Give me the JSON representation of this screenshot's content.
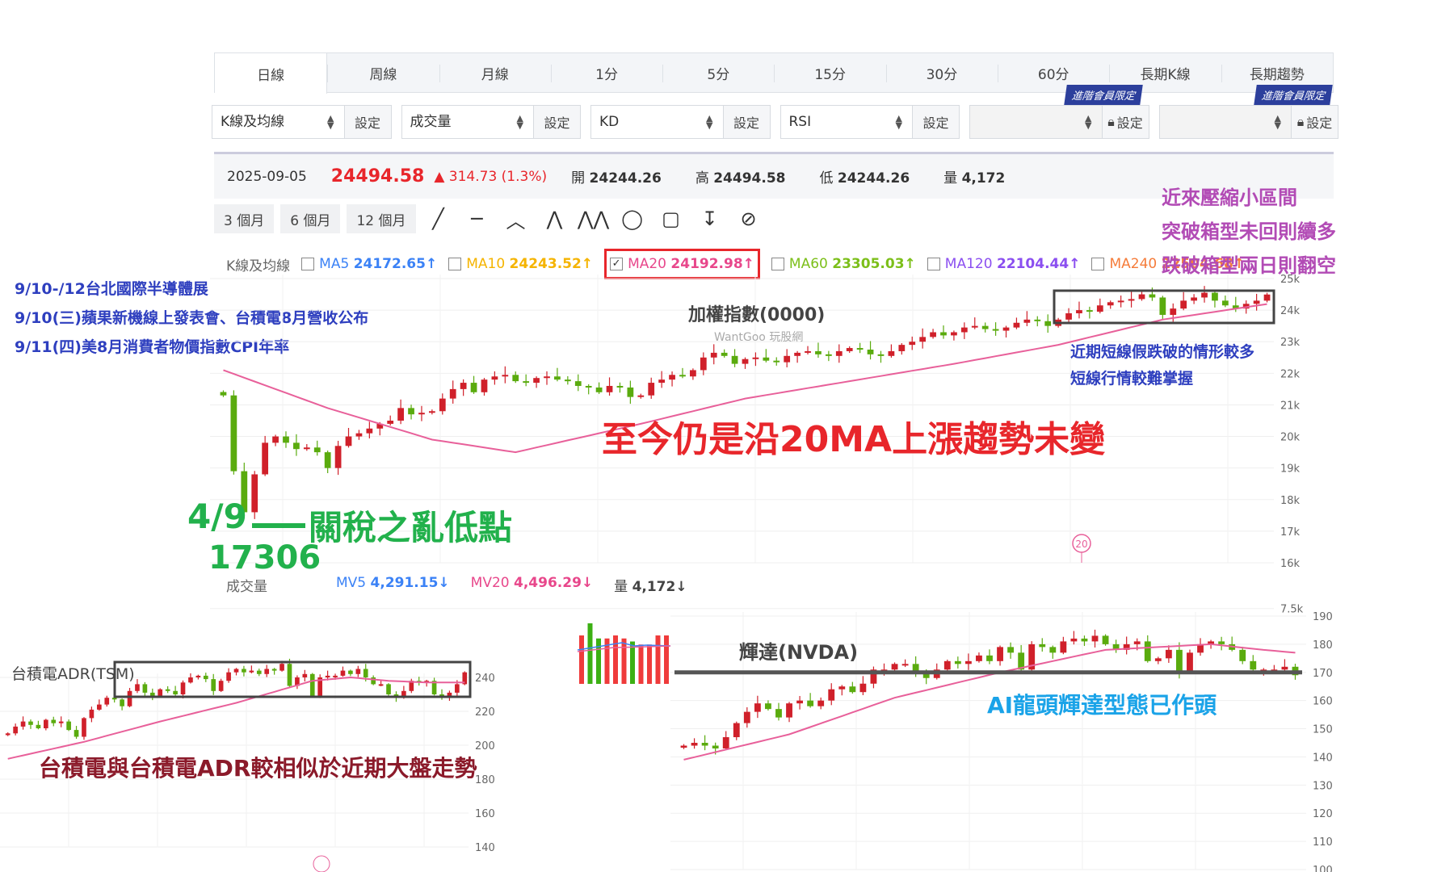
{
  "tabs": [
    "日線",
    "周線",
    "月線",
    "1分",
    "5分",
    "15分",
    "30分",
    "60分",
    "長期K線",
    "長期趨勢"
  ],
  "selectors": [
    {
      "value": "K線及均線",
      "button": "設定"
    },
    {
      "value": "成交量",
      "button": "設定"
    },
    {
      "value": "KD",
      "button": "設定"
    },
    {
      "value": "RSI",
      "button": "設定"
    },
    {
      "value": "",
      "button": "設定",
      "badge": "進階會員限定"
    },
    {
      "value": "",
      "button": "設定",
      "badge": "進階會員限定"
    }
  ],
  "info": {
    "date": "2025-09-05",
    "price": "24494.58",
    "change": "▲ 314.73 (1.3%)",
    "open_label": "開",
    "open": "24244.26",
    "high_label": "高",
    "high": "24494.58",
    "low_label": "低",
    "low": "24244.26",
    "vol_label": "量",
    "vol": "4,172"
  },
  "periods": [
    "3 個月",
    "6 個月",
    "12 個月"
  ],
  "tool_icons": [
    "line-tool",
    "horizontal-line-tool",
    "angle-tool",
    "abcd-pattern-tool",
    "xabcd-pattern-tool",
    "circle-tool",
    "rectangle-tool",
    "text-tool",
    "hide-drawings-tool"
  ],
  "ma_legend": {
    "label": "K線及均線",
    "items": [
      {
        "name": "MA5",
        "value": "24172.65↑",
        "color": "#3b82f6",
        "checked": false
      },
      {
        "name": "MA10",
        "value": "24243.52↑",
        "color": "#f5b400",
        "checked": false
      },
      {
        "name": "MA20",
        "value": "24192.98↑",
        "color": "#e8478b",
        "checked": true
      },
      {
        "name": "MA60",
        "value": "23305.03↑",
        "color": "#7cbf1a",
        "checked": false
      },
      {
        "name": "MA120",
        "value": "22104.44↑",
        "color": "#8b4ff0",
        "checked": false
      },
      {
        "name": "MA240",
        "value": "22504.68↑",
        "color": "#f57c3a",
        "checked": false
      }
    ]
  },
  "events": [
    "9/10-/12台北國際半導體展",
    "9/10(三)蘋果新機線上發表會、台積電8月營收公布",
    "9/11(四)美8月消費者物價指數CPI年率"
  ],
  "annotations": {
    "box_note": [
      "近來壓縮小區間",
      "突破箱型未回則續多",
      "跌破箱型兩日則翻空"
    ],
    "short_note": [
      "近期短線假跌破的情形較多",
      "短線行情較難掌握"
    ],
    "trend": "至今仍是沿20MA上漲趨勢未變",
    "low_date": "4/9",
    "low_text": "關稅之亂低點",
    "low_value": "17306",
    "tsm_note": "台積電與台積電ADR較相似於近期大盤走勢",
    "nvda_note": "AI龍頭輝達型態已作頭"
  },
  "main_chart": {
    "title": "加權指數(0000)",
    "watermark": "WantGoo 玩股網",
    "marker": "20"
  },
  "volume_legend": {
    "label": "成交量",
    "mv5": "MV5",
    "mv5_value": "4,291.15↓",
    "mv20": "MV20",
    "mv20_value": "4,496.29↓",
    "vol": "量",
    "vol_value": "4,172↓"
  },
  "colors": {
    "up": "#d0202a",
    "down": "#5aab0e",
    "ma20": "#e8609a"
  },
  "chart_data": [
    {
      "type": "candlestick",
      "title": "加權指數(0000)",
      "yticks": [
        "25k",
        "24k",
        "23k",
        "22k",
        "21k",
        "20k",
        "19k",
        "18k",
        "17k",
        "16k",
        "7.5k"
      ],
      "ylim": [
        16000,
        25000
      ],
      "close": [
        21300,
        18900,
        17600,
        18800,
        19800,
        20000,
        19800,
        19600,
        19650,
        19500,
        19000,
        19700,
        20000,
        20100,
        20250,
        20400,
        20500,
        20900,
        20700,
        20750,
        20800,
        21200,
        21500,
        21700,
        21400,
        21800,
        21900,
        21950,
        21750,
        21700,
        21850,
        21900,
        21800,
        21750,
        21600,
        21550,
        21400,
        21600,
        21550,
        21250,
        21300,
        21700,
        21800,
        21950,
        21900,
        22100,
        22500,
        22650,
        22550,
        22300,
        22450,
        22500,
        22400,
        22350,
        22550,
        22650,
        22700,
        22600,
        22550,
        22700,
        22800,
        22750,
        22600,
        22550,
        22700,
        22900,
        23000,
        23150,
        23300,
        23200,
        23300,
        23450,
        23500,
        23400,
        23350,
        23450,
        23600,
        23700,
        23650,
        23500,
        23700,
        23900,
        24000,
        23950,
        24150,
        24250,
        24300,
        24350,
        24500,
        24400,
        23850,
        24050,
        24300,
        24400,
        24550,
        24300,
        24150,
        24050,
        24200,
        24300,
        24494.58
      ],
      "ma20_knots": [
        [
          0,
          22100
        ],
        [
          10,
          20900
        ],
        [
          20,
          19900
        ],
        [
          28,
          19500
        ],
        [
          40,
          20400
        ],
        [
          50,
          21200
        ],
        [
          60,
          21750
        ],
        [
          70,
          22300
        ],
        [
          80,
          22900
        ],
        [
          90,
          23700
        ],
        [
          100,
          24193
        ]
      ]
    },
    {
      "type": "candlestick",
      "title": "台積電ADR(TSM)",
      "yticks": [
        "240",
        "220",
        "200",
        "180",
        "160",
        "140"
      ],
      "ylim": [
        140,
        240
      ],
      "close": [
        207,
        211,
        214,
        212,
        210,
        215,
        213,
        214,
        209,
        205,
        216,
        221,
        224,
        228,
        227,
        223,
        232,
        236,
        231,
        229,
        233,
        232,
        230,
        237,
        240,
        241,
        239,
        232,
        238,
        243,
        245,
        243,
        244,
        242,
        245,
        244,
        248,
        235,
        240,
        242,
        229,
        240,
        241,
        241,
        244,
        242,
        245,
        240,
        236,
        236,
        230,
        228,
        232,
        238,
        237,
        238,
        230,
        228,
        231,
        236,
        243
      ],
      "ma20_knots": [
        [
          0,
          192
        ],
        [
          10,
          202
        ],
        [
          20,
          214
        ],
        [
          30,
          225
        ],
        [
          40,
          238
        ],
        [
          45,
          240
        ],
        [
          50,
          238
        ],
        [
          55,
          237
        ],
        [
          60,
          237
        ]
      ],
      "marker": "20"
    },
    {
      "type": "candlestick",
      "title": "輝達(NVDA)",
      "yticks": [
        "190",
        "180",
        "170",
        "160",
        "150",
        "140",
        "130",
        "120",
        "110",
        "100"
      ],
      "ylim": [
        100,
        190
      ],
      "close": [
        144,
        145,
        144,
        143,
        147,
        152,
        156,
        159,
        157,
        154,
        159,
        160,
        158,
        160,
        164,
        165,
        163,
        166,
        171,
        171,
        173,
        173,
        170,
        168,
        171,
        174,
        173,
        174,
        176,
        174,
        179,
        177,
        171,
        180,
        179,
        177,
        181,
        182,
        181,
        183,
        180,
        178,
        180,
        181,
        174,
        175,
        178,
        170,
        177,
        180,
        181,
        180,
        178,
        174,
        171,
        171,
        171,
        172,
        169
      ],
      "ma20_knots": [
        [
          0,
          139
        ],
        [
          10,
          148
        ],
        [
          20,
          161
        ],
        [
          30,
          170
        ],
        [
          40,
          178
        ],
        [
          45,
          179
        ],
        [
          50,
          180
        ],
        [
          55,
          178
        ],
        [
          58,
          177
        ]
      ],
      "support": 170
    },
    {
      "type": "bar",
      "title": "volume-mini",
      "values": [
        8,
        10,
        7.5,
        7.5,
        8,
        7.5,
        7,
        6.5,
        6.5,
        8,
        8
      ],
      "up": [
        true,
        false,
        false,
        true,
        true,
        true,
        false,
        true,
        true,
        true,
        true
      ]
    }
  ]
}
